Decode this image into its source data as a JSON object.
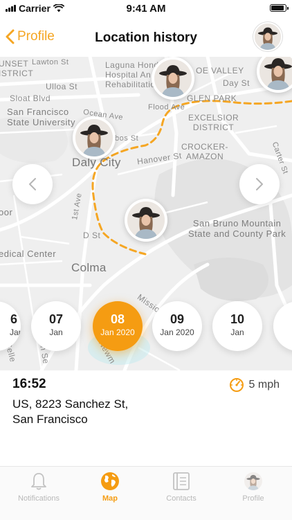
{
  "status_bar": {
    "carrier": "Carrier",
    "time": "9:41 AM"
  },
  "nav": {
    "back_label": "Profile",
    "title": "Location history"
  },
  "map_labels": {
    "sunset_district": "UNSET\nISTRICT",
    "lawton": "Lawton St",
    "laguna": "Laguna Honda\nHospital An\nRehabilitation C",
    "de_valley": "OE VALLEY",
    "ulloa": "Ulloa St",
    "day_st": "Day St",
    "sloat": "Sloat Blvd",
    "glen_park": "GLEN PARK",
    "flood_ave": "Flood Ave",
    "sfsu": "San Francisco\nState University",
    "ocean_ave": "Ocean Ave",
    "excelsior": "EXCELSIOR\nDISTRICT",
    "daly_city": "Daly City",
    "hanover": "Hanover St",
    "crocker": "CROCKER-\nAMAZON",
    "first_ave": "1st Ave",
    "oor": "oor",
    "d_st": "D St",
    "san_bruno": "San Bruno Mountain\nState and County Park",
    "medical": "edical Center",
    "colma": "Colma",
    "mission": "Missio",
    "newman": "Newm",
    "san_se": "an Se",
    "selle": "Selle",
    "bos_st": "bos St",
    "carter": "Carter St"
  },
  "dates": [
    {
      "day": "6",
      "month": "Jan"
    },
    {
      "day": "07",
      "month": "Jan"
    },
    {
      "day": "08",
      "month": "Jan 2020"
    },
    {
      "day": "09",
      "month": "Jan 2020"
    },
    {
      "day": "10",
      "month": "Jan"
    }
  ],
  "selected_date_index": 2,
  "detail": {
    "time": "16:52",
    "speed": "5 mph",
    "address_line1": "US, 8223 Sanchez St,",
    "address_line2": "San Francisco"
  },
  "tabs": [
    {
      "label": "Notifications",
      "icon": "bell-icon",
      "active": false
    },
    {
      "label": "Map",
      "icon": "globe-icon",
      "active": true
    },
    {
      "label": "Contacts",
      "icon": "contacts-icon",
      "active": false
    },
    {
      "label": "Profile",
      "icon": "avatar",
      "active": false
    }
  ],
  "colors": {
    "accent": "#f59c12",
    "route": "#f5a623"
  }
}
